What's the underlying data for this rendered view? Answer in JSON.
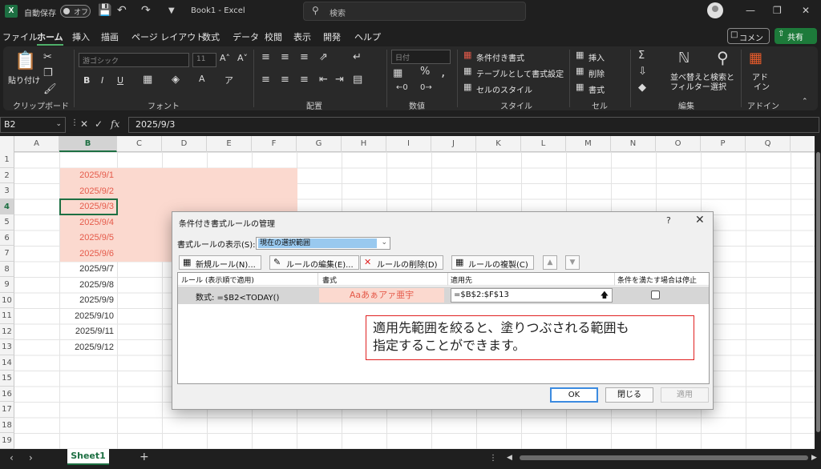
{
  "titlebar": {
    "autosave_label": "自動保存",
    "toggle_label": "オフ",
    "doc_title": "Book1 - Excel",
    "search_placeholder": "検索"
  },
  "menu": {
    "tabs": [
      "ファイル",
      "ホーム",
      "挿入",
      "描画",
      "ページ レイアウト",
      "数式",
      "データ",
      "校閲",
      "表示",
      "開発",
      "ヘルプ"
    ],
    "active": "ホーム",
    "comment_label": "コメント",
    "share_label": "共有"
  },
  "ribbon": {
    "clipboard": {
      "paste": "貼り付け",
      "label": "クリップボード"
    },
    "font": {
      "name": "游ゴシック",
      "size": "11",
      "label": "フォント"
    },
    "alignment": {
      "label": "配置"
    },
    "number": {
      "format": "日付",
      "label": "数値"
    },
    "styles": {
      "conditional": "条件付き書式",
      "table": "テーブルとして書式設定",
      "cell_styles": "セルのスタイル",
      "label": "スタイル"
    },
    "cells": {
      "insert": "挿入",
      "delete": "削除",
      "format": "書式",
      "label": "セル"
    },
    "editing": {
      "sort": "並べ替えと",
      "sort2": "フィルター",
      "find": "検索と",
      "find2": "選択",
      "label": "編集"
    },
    "addins": {
      "label1": "アド",
      "label2": "イン",
      "label": "アドイン"
    }
  },
  "formula_bar": {
    "name_box": "B2",
    "formula": "2025/9/3"
  },
  "grid": {
    "columns": [
      "A",
      "B",
      "C",
      "D",
      "E",
      "F",
      "G",
      "H",
      "I",
      "J",
      "K",
      "L",
      "M",
      "N",
      "O",
      "P",
      "Q"
    ],
    "rows": [
      "1",
      "2",
      "3",
      "4",
      "5",
      "6",
      "7",
      "8",
      "9",
      "10",
      "11",
      "12",
      "13",
      "14",
      "15",
      "16",
      "17",
      "18",
      "19"
    ],
    "b_values": [
      "2025/9/1",
      "2025/9/2",
      "2025/9/3",
      "2025/9/4",
      "2025/9/5",
      "2025/9/6",
      "2025/9/7",
      "2025/9/8",
      "2025/9/9",
      "2025/9/10",
      "2025/9/11",
      "2025/9/12"
    ]
  },
  "sheets": {
    "active": "Sheet1"
  },
  "dialog": {
    "title": "条件付き書式ルールの管理",
    "help": "?",
    "show_label": "書式ルールの表示(S):",
    "show_value": "現在の選択範囲",
    "buttons": {
      "new": "新規ルール(N)...",
      "edit": "ルールの編集(E)...",
      "delete": "ルールの削除(D)",
      "duplicate": "ルールの複製(C)"
    },
    "headers": {
      "rule": "ルール (表示順で適用)",
      "format": "書式",
      "applies_to": "適用先",
      "stop_if_true": "条件を満たす場合は停止"
    },
    "rule": {
      "condition": "数式: =$B2<TODAY()",
      "format_preview": "Aaあぁアァ亜宇",
      "applies_to": "=$B$2:$F$13"
    },
    "callout_line1": "適用先範囲を絞ると、塗りつぶされる範囲も",
    "callout_line2": "指定することができます。",
    "ok": "OK",
    "close": "閉じる",
    "apply": "適用"
  },
  "colors": {
    "accent": "#1d6f42",
    "highlight_fill": "#fbd9cf",
    "highlight_text": "#e55a4a",
    "callout_border": "#e02020"
  }
}
